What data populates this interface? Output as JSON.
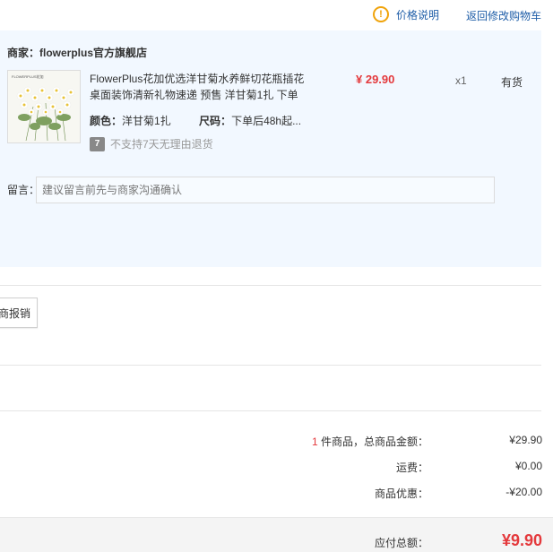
{
  "header": {
    "price_info_link": "价格说明",
    "back_to_cart_link": "返回修改购物车"
  },
  "shop": {
    "label": "商家：",
    "name": "flowerplus官方旗舰店"
  },
  "product": {
    "image_brand_text": "FLOWERPLUS花加",
    "title": "FlowerPlus花加优选洋甘菊水养鲜切花瓶插花桌面装饰清新礼物速递 预售 洋甘菊1扎 下单",
    "price": "¥ 29.90",
    "quantity": "x1",
    "stock_status": "有货",
    "color_label": "颜色：",
    "color_value": "洋甘菊1扎",
    "size_label": "尺码：",
    "size_value": "下单后48h起...",
    "return_icon_text": "7",
    "return_policy": "不支持7天无理由退货"
  },
  "memo": {
    "label": "留言：",
    "placeholder": "建议留言前先与商家沟通确认"
  },
  "reimburse_button": "商报销",
  "summary": {
    "item_count": "1",
    "item_total_label": " 件商品，总商品金额：",
    "item_total_value": "¥29.90",
    "shipping_label": "运费：",
    "shipping_value": "¥0.00",
    "discount_label": "商品优惠：",
    "discount_value": "-¥20.00",
    "payable_label": "应付总额：",
    "payable_value": "¥9.90"
  },
  "colors": {
    "accent_red": "#e4393c",
    "link_blue": "#1f5ea8",
    "panel_bg": "#f2f8ff",
    "warning_orange": "#f0a30a"
  },
  "icons": [
    "info-icon",
    "seven-day-return-icon"
  ]
}
